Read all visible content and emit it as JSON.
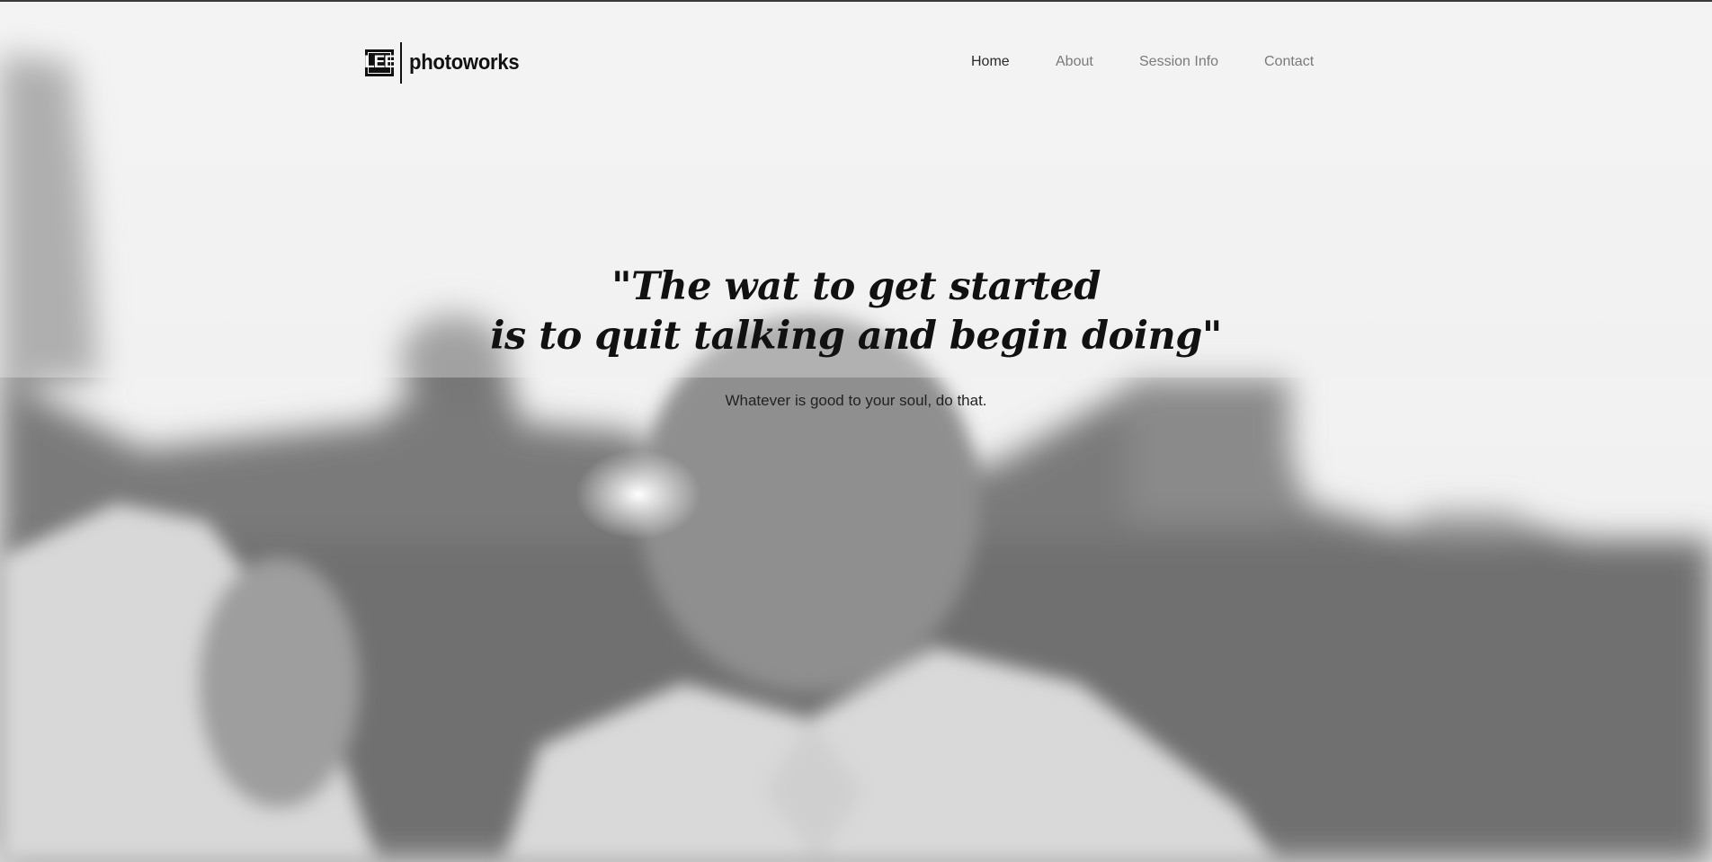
{
  "brand": {
    "mark": "LEE",
    "name": "photoworks"
  },
  "nav": {
    "items": [
      {
        "label": "Home",
        "active": true
      },
      {
        "label": "About",
        "active": false
      },
      {
        "label": "Session Info",
        "active": false
      },
      {
        "label": "Contact",
        "active": false
      }
    ]
  },
  "hero": {
    "quote_line_1": "\"The wat to get started",
    "quote_line_2": "is to quit talking and begin doing\"",
    "subtitle": "Whatever is good to your soul, do that."
  },
  "colors": {
    "text_dark": "#111111",
    "nav_inactive": "#7a7a7a",
    "background_light": "#f3f3f3",
    "top_border": "#3a3a3a"
  }
}
